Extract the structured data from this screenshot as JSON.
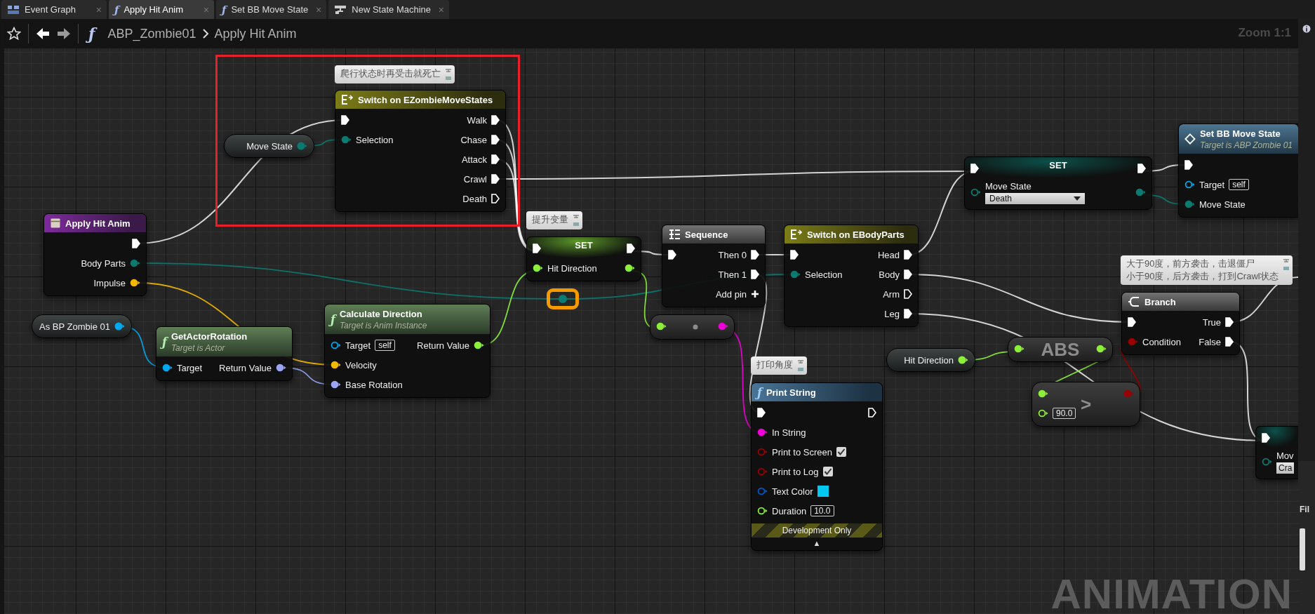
{
  "tabs": [
    {
      "label": "Event Graph",
      "kind": "graph",
      "close": "×",
      "selected": false
    },
    {
      "label": "Apply Hit Anim",
      "glyph": "ƒ",
      "close": "×",
      "selected": true
    },
    {
      "label": "Set BB Move State",
      "glyph": "ƒ",
      "close": "×",
      "selected": false
    },
    {
      "label": "New State Machine",
      "kind": "state_machine",
      "close": "×",
      "selected": false
    }
  ],
  "breadcrumb": {
    "glyph": "ƒ",
    "parts": [
      "ABP_Zombie01",
      "Apply Hit Anim"
    ]
  },
  "zoom_label": "Zoom 1:1",
  "graph_label": "ANIMATION",
  "comments": [
    {
      "lines": [
        "爬行状态时再受击就死亡"
      ]
    },
    {
      "lines": [
        "提升变量"
      ]
    },
    {
      "lines": [
        "大于90度，前方袭击，击退僵尸",
        "小于90度，后方袭击，打到Crawl状态"
      ]
    },
    {
      "lines": [
        "打印角度"
      ]
    }
  ],
  "reroutes": [
    {
      "kind": "enum",
      "selected": true
    }
  ],
  "nodes": [
    {
      "kind": "getter",
      "label": "Move State",
      "pin": {
        "kind": "enum",
        "connected": true
      }
    },
    {
      "kind": "switch",
      "title": "Switch on EZombieMoveStates",
      "rows": [
        {
          "left": {
            "kind": "exec",
            "connected": true
          },
          "right": {
            "kind": "exec",
            "label": "Walk",
            "connected": true
          }
        },
        {
          "left": {
            "kind": "enum",
            "label": "Selection",
            "connected": true
          },
          "right": {
            "kind": "exec",
            "label": "Chase",
            "connected": true
          }
        },
        {
          "right": {
            "kind": "exec",
            "label": "Attack",
            "connected": true
          }
        },
        {
          "right": {
            "kind": "exec",
            "label": "Crawl",
            "connected": true
          }
        },
        {
          "right": {
            "kind": "exec",
            "label": "Death",
            "connected": false
          }
        }
      ]
    },
    {
      "kind": "set",
      "title": "SET",
      "rows": [
        {
          "left": {
            "kind": "exec",
            "connected": true
          },
          "right": {
            "kind": "exec",
            "connected": true
          }
        },
        {
          "left": {
            "kind": "enum",
            "label": "Move State",
            "dropdown": "Death",
            "connected": false
          },
          "right": {
            "kind": "enum",
            "connected": true
          }
        }
      ]
    },
    {
      "kind": "message",
      "title": "Set BB Move State",
      "subtitle": "Target is ABP Zombie 01",
      "cut": true,
      "rows": [
        {
          "left": {
            "kind": "exec",
            "connected": true
          }
        },
        {
          "left": {
            "kind": "object",
            "label": "Target",
            "value": "self",
            "connected": false
          }
        },
        {
          "left": {
            "kind": "enum",
            "label": "Move State",
            "connected": true
          }
        }
      ]
    },
    {
      "kind": "event",
      "title": "Apply Hit Anim",
      "rows": [
        {
          "right": {
            "kind": "exec",
            "connected": true
          }
        },
        {
          "right": {
            "kind": "enum",
            "label": "Body Parts",
            "connected": true
          }
        },
        {
          "right": {
            "kind": "vector",
            "label": "Impulse",
            "connected": true
          }
        }
      ]
    },
    {
      "kind": "set",
      "title": "SET",
      "rows": [
        {
          "left": {
            "kind": "exec",
            "connected": true
          },
          "right": {
            "kind": "exec",
            "connected": true
          }
        },
        {
          "left": {
            "kind": "float",
            "label": "Hit Direction",
            "connected": true
          },
          "right": {
            "kind": "float",
            "connected": true
          }
        }
      ]
    },
    {
      "kind": "sequence",
      "title": "Sequence",
      "rows": [
        {
          "left": {
            "kind": "exec",
            "connected": true
          },
          "right": {
            "kind": "exec",
            "label": "Then 0",
            "connected": true
          }
        },
        {
          "right": {
            "kind": "exec",
            "label": "Then 1",
            "connected": true
          }
        },
        {
          "right": {
            "kind": "add",
            "label": "Add pin"
          }
        }
      ]
    },
    {
      "kind": "switch",
      "title": "Switch on EBodyParts",
      "rows": [
        {
          "left": {
            "kind": "exec",
            "connected": true
          },
          "right": {
            "kind": "exec",
            "label": "Head",
            "connected": true
          }
        },
        {
          "left": {
            "kind": "enum",
            "label": "Selection",
            "connected": true
          },
          "right": {
            "kind": "exec",
            "label": "Body",
            "connected": true
          }
        },
        {
          "right": {
            "kind": "exec",
            "label": "Arm",
            "connected": false
          }
        },
        {
          "right": {
            "kind": "exec",
            "label": "Leg",
            "connected": true
          }
        }
      ]
    },
    {
      "kind": "branch",
      "title": "Branch",
      "rows": [
        {
          "left": {
            "kind": "exec",
            "connected": true
          },
          "right": {
            "kind": "exec",
            "label": "True",
            "connected": true
          }
        },
        {
          "left": {
            "kind": "bool",
            "label": "Condition",
            "connected": true
          },
          "right": {
            "kind": "exec",
            "label": "False",
            "connected": true
          }
        }
      ]
    },
    {
      "kind": "getter",
      "label": "As BP Zombie 01",
      "pin": {
        "kind": "object",
        "connected": true
      }
    },
    {
      "kind": "pure",
      "glyph": "ƒ",
      "title": "GetActorRotation",
      "subtitle": "Target is Actor",
      "rows": [
        {
          "left": {
            "kind": "object",
            "label": "Target",
            "connected": true
          },
          "right": {
            "kind": "rotator",
            "label": "Return Value",
            "connected": true
          }
        }
      ]
    },
    {
      "kind": "pure",
      "glyph": "ƒ",
      "title": "Calculate Direction",
      "subtitle": "Target is Anim Instance",
      "rows": [
        {
          "left": {
            "kind": "object",
            "label": "Target",
            "value": "self",
            "connected": false
          },
          "right": {
            "kind": "float",
            "label": "Return Value",
            "connected": true
          }
        },
        {
          "left": {
            "kind": "vector",
            "label": "Velocity",
            "connected": true
          }
        },
        {
          "left": {
            "kind": "rotator",
            "label": "Base Rotation",
            "connected": true
          }
        }
      ]
    },
    {
      "kind": "convert",
      "rows": [
        {
          "left": {
            "kind": "float",
            "connected": true
          },
          "right": {
            "kind": "string",
            "connected": true
          }
        }
      ]
    },
    {
      "kind": "getter",
      "label": "Hit Direction",
      "pin": {
        "kind": "float",
        "connected": true
      }
    },
    {
      "kind": "compact",
      "title": "ABS",
      "rows": [
        {
          "left": {
            "kind": "float",
            "connected": true
          },
          "right": {
            "kind": "float",
            "connected": true
          }
        }
      ]
    },
    {
      "kind": "compact",
      "title": ">",
      "rows": [
        {
          "left": {
            "kind": "float",
            "connected": true
          },
          "right": {
            "kind": "bool",
            "connected": true
          }
        },
        {
          "left": {
            "kind": "float",
            "value": "90.0",
            "connected": false
          }
        }
      ]
    },
    {
      "kind": "function",
      "glyph": "ƒ",
      "title": "Print String",
      "banner": "Development Only",
      "expand": "▲",
      "rows": [
        {
          "left": {
            "kind": "exec",
            "connected": true
          },
          "right": {
            "kind": "exec",
            "connected": false
          }
        },
        {
          "left": {
            "kind": "string",
            "label": "In String",
            "connected": true
          }
        },
        {
          "left": {
            "kind": "bool",
            "label": "Print to Screen",
            "checked": true,
            "connected": false
          }
        },
        {
          "left": {
            "kind": "bool",
            "label": "Print to Log",
            "checked": true,
            "connected": false
          }
        },
        {
          "left": {
            "kind": "color",
            "label": "Text Color",
            "color": "#00c8f0",
            "connected": false
          }
        },
        {
          "left": {
            "kind": "float",
            "label": "Duration",
            "value": "10.0",
            "connected": false
          }
        }
      ]
    },
    {
      "kind": "set",
      "cut": true,
      "rows": [
        {
          "left": {
            "kind": "exec",
            "connected": true
          }
        },
        {
          "left": {
            "kind": "enum",
            "label": "Mov",
            "dropdown": "Cra",
            "connected": false
          }
        }
      ]
    }
  ],
  "side_panel": {
    "label": "Fil"
  }
}
